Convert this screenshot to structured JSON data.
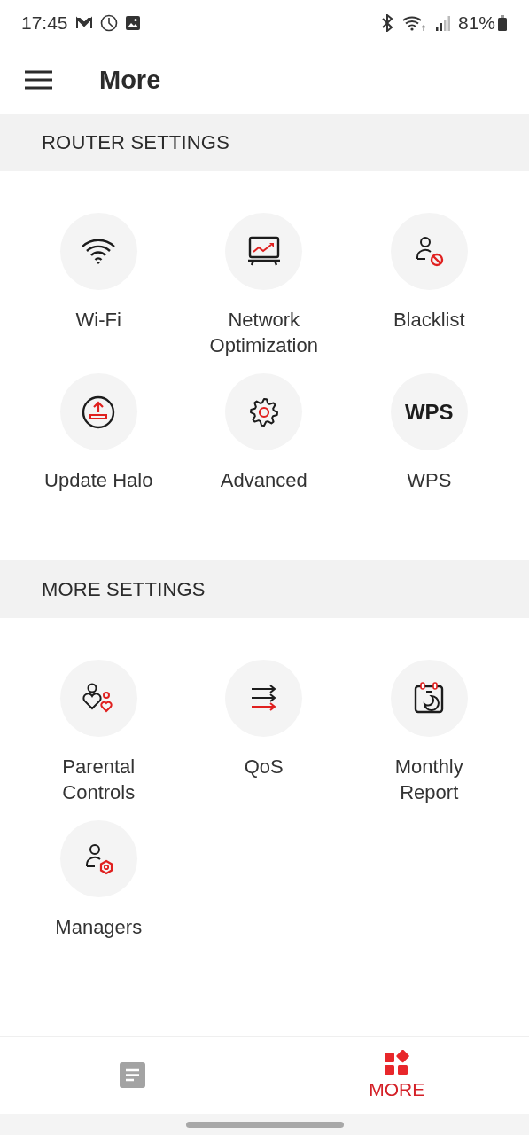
{
  "status_bar": {
    "time": "17:45",
    "battery": "81%"
  },
  "app_bar": {
    "title": "More"
  },
  "sections": [
    {
      "title": "ROUTER SETTINGS",
      "items": [
        {
          "label": "Wi-Fi"
        },
        {
          "label": "Network Optimization"
        },
        {
          "label": "Blacklist"
        },
        {
          "label": "Update Halo"
        },
        {
          "label": "Advanced"
        },
        {
          "label": "WPS",
          "icon_text": "WPS"
        }
      ]
    },
    {
      "title": "MORE SETTINGS",
      "items": [
        {
          "label": "Parental Controls"
        },
        {
          "label": "QoS"
        },
        {
          "label": "Monthly Report"
        },
        {
          "label": "Managers"
        }
      ]
    }
  ],
  "bottom_nav": [
    {
      "selected": false
    },
    {
      "label": "MORE",
      "selected": true
    }
  ]
}
